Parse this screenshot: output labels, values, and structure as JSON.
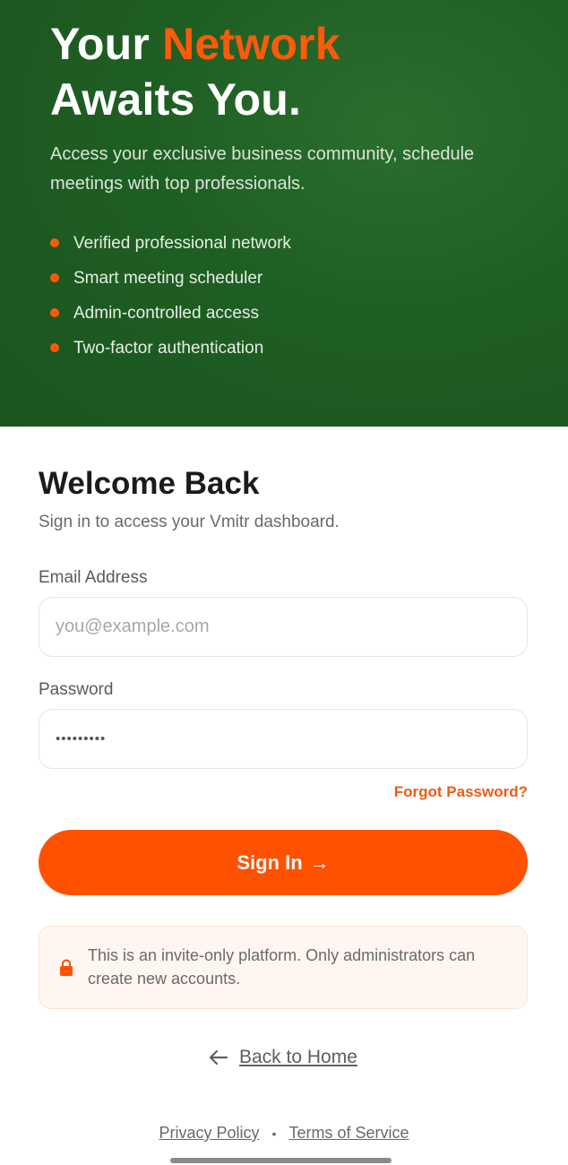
{
  "hero": {
    "title_part1": "Your ",
    "title_accent": "Network",
    "title_line2": "Awaits You.",
    "subtitle": "Access your exclusive business community, schedule meetings with top professionals.",
    "features": [
      "Verified professional network",
      "Smart meeting scheduler",
      "Admin-controlled access",
      "Two-factor authentication"
    ]
  },
  "login": {
    "title": "Welcome Back",
    "subtitle": "Sign in to access your Vmitr dashboard.",
    "email_label": "Email Address",
    "email_placeholder": "you@example.com",
    "email_value": "",
    "password_label": "Password",
    "password_value": "•••••••••",
    "forgot_label": "Forgot Password?",
    "signin_label": "Sign In",
    "signin_arrow": "→"
  },
  "notice": {
    "text": "This is an invite-only platform. Only administrators can create new accounts.",
    "icon": "lock-icon"
  },
  "back_label": "Back to Home",
  "footer": {
    "privacy": "Privacy Policy",
    "separator": "•",
    "terms": "Terms of Service"
  },
  "colors": {
    "accent": "#ff5100",
    "hero_green": "#1f5e23"
  }
}
